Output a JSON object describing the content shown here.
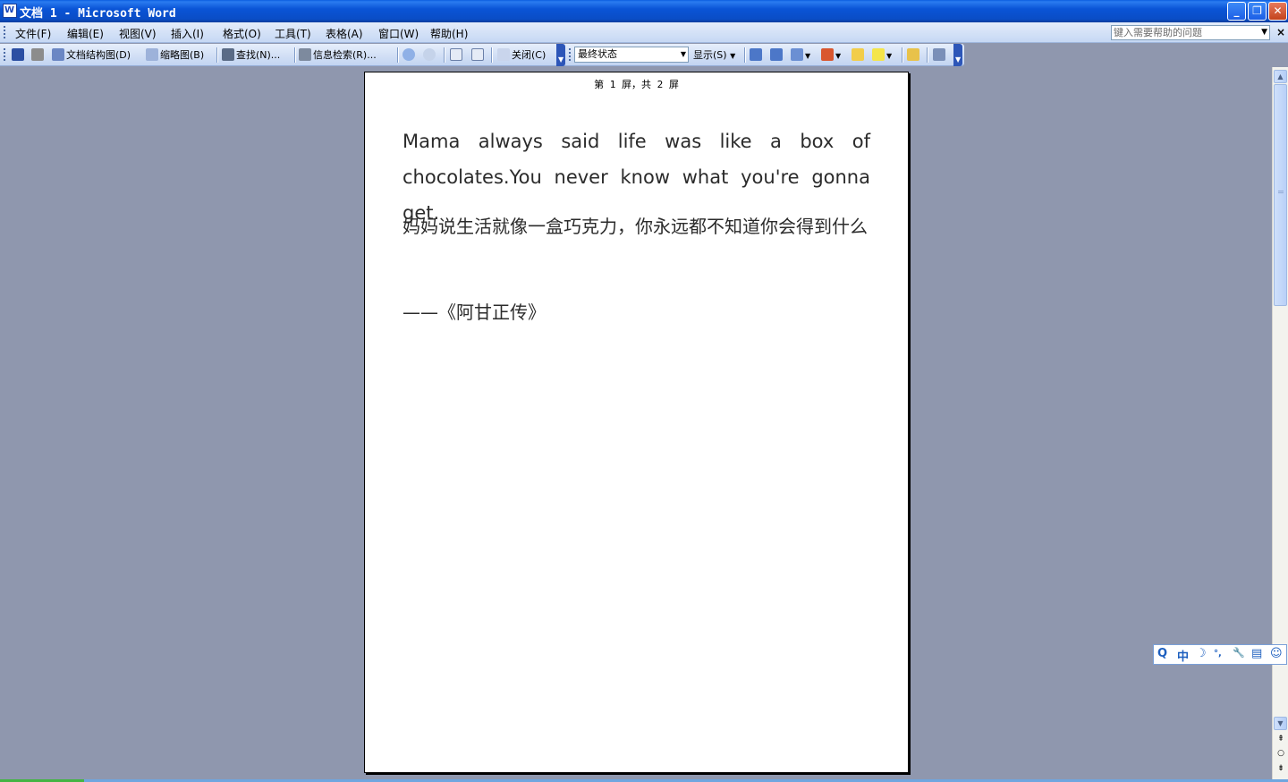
{
  "window": {
    "title": "文档 1 - Microsoft Word",
    "app_icon": "W",
    "minimize": "_",
    "restore": "❐",
    "close": "✕"
  },
  "menubar": {
    "items": [
      {
        "label": "文件(F)"
      },
      {
        "label": "编辑(E)"
      },
      {
        "label": "视图(V)"
      },
      {
        "label": "插入(I)"
      },
      {
        "label": "格式(O)"
      },
      {
        "label": "工具(T)"
      },
      {
        "label": "表格(A)"
      },
      {
        "label": "窗口(W)"
      },
      {
        "label": "帮助(H)"
      }
    ],
    "help_placeholder": "键入需要帮助的问题",
    "close_doc": "×"
  },
  "toolbar": {
    "doc_map": "文档结构图(D)",
    "thumbnails": "缩略图(B)",
    "find": "查找(N)...",
    "research": "信息检索(R)...",
    "close": "关闭(C)",
    "display_state": "最终状态",
    "show": "显示(S)"
  },
  "document": {
    "page_indicator": "第 1 屏，共 2 屏",
    "paragraph_en": "Mama always said life was like a box of chocolates.You never know what you're gonna get.",
    "paragraph_zh": "妈妈说生活就像一盒巧克力，你永远都不知道你会得到什么",
    "source": "——《阿甘正传》"
  },
  "ime": {
    "items": [
      "Q",
      "中",
      "☽",
      "°,",
      "🔧",
      "▤",
      "☺"
    ]
  },
  "colors": {
    "titlebar": "#0a54d6",
    "workspace": "#8f97ae",
    "page": "#ffffff"
  }
}
